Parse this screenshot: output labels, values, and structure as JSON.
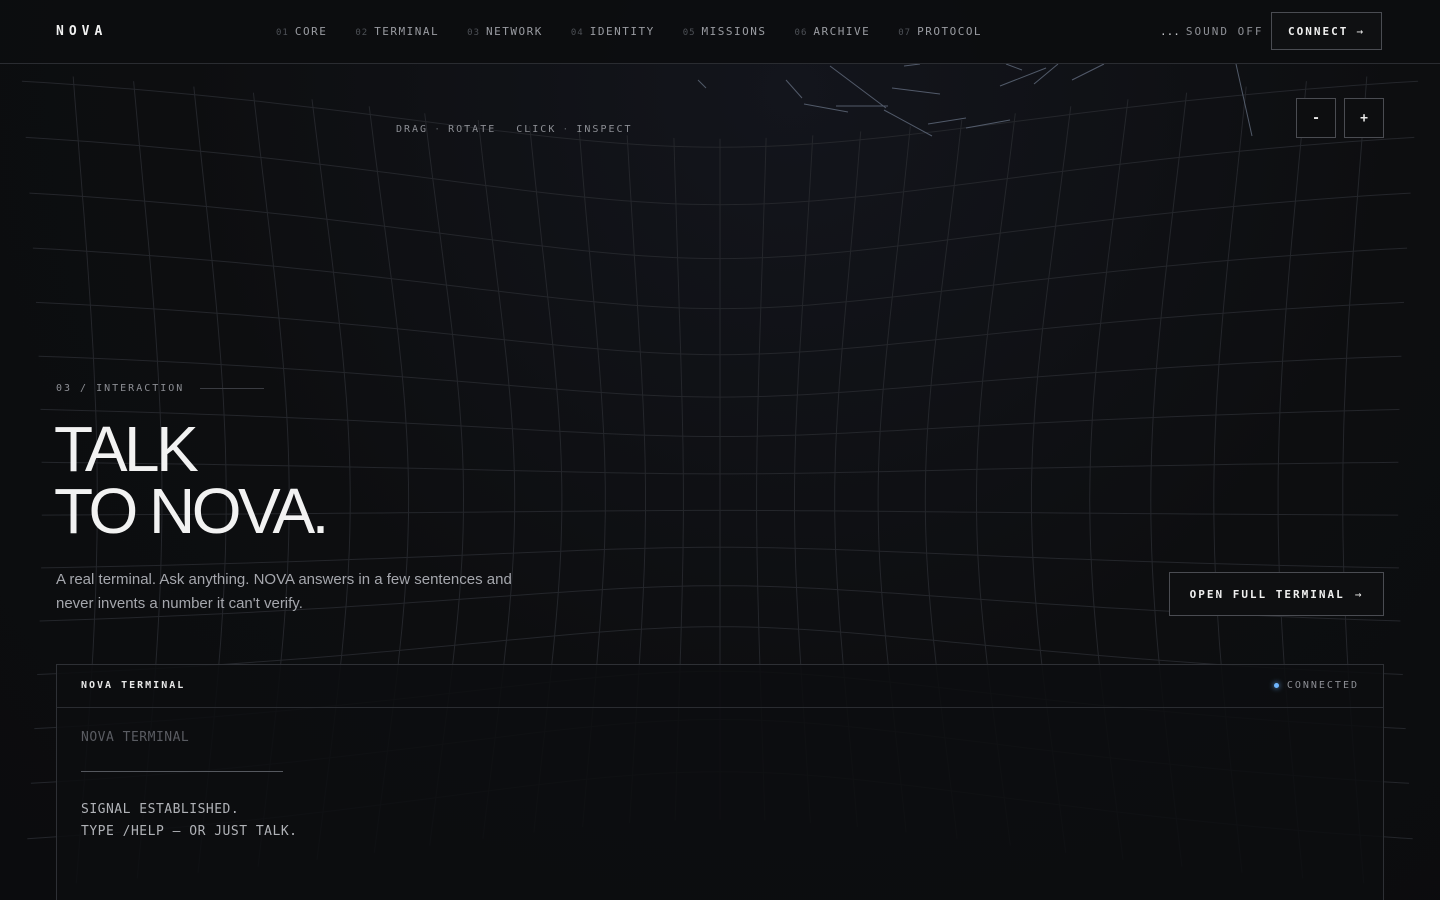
{
  "nav": {
    "logo": "NOVA",
    "links": [
      {
        "num": "01",
        "label": "CORE"
      },
      {
        "num": "02",
        "label": "TERMINAL"
      },
      {
        "num": "03",
        "label": "NETWORK"
      },
      {
        "num": "04",
        "label": "IDENTITY"
      },
      {
        "num": "05",
        "label": "MISSIONS"
      },
      {
        "num": "06",
        "label": "ARCHIVE"
      },
      {
        "num": "07",
        "label": "PROTOCOL"
      }
    ],
    "sound_indicator": "...",
    "sound_label": "SOUND OFF",
    "connect_label": "CONNECT",
    "connect_arrow": "→"
  },
  "viewer": {
    "hint_drag": "DRAG",
    "hint_rotate": "ROTATE",
    "hint_click": "CLICK",
    "hint_inspect": "INSPECT",
    "hint_sep": "·",
    "zoom_out_label": "-",
    "zoom_in_label": "+"
  },
  "section": {
    "label": "03 / INTERACTION",
    "headline_line1": "TALK",
    "headline_line2": "TO NOVA.",
    "subtext": "A real terminal. Ask anything. NOVA answers in a few sentences and never invents a number it can't verify.",
    "open_terminal_label": "OPEN FULL TERMINAL",
    "open_terminal_arrow": "→"
  },
  "terminal": {
    "title": "NOVA TERMINAL",
    "status": "CONNECTED",
    "banner": "NOVA TERMINAL",
    "line1": "SIGNAL ESTABLISHED.",
    "line2": "TYPE /HELP — OR JUST TALK."
  },
  "colors": {
    "background": "#0d0e10",
    "status_dot": "#6fb6ff",
    "border": "#4a4c52"
  }
}
